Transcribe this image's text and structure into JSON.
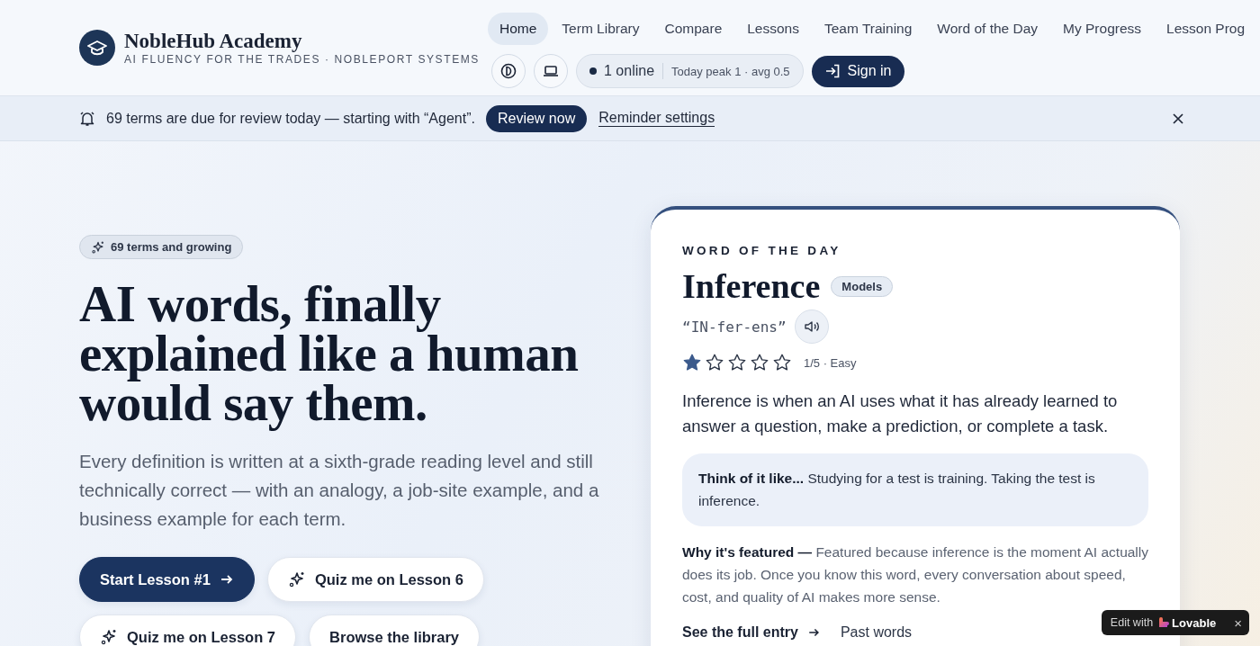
{
  "brand": {
    "name": "NobleHub Academy",
    "tagline": "AI FLUENCY FOR THE TRADES · NOBLEPORT SYSTEMS"
  },
  "nav": [
    {
      "label": "Home",
      "selected": true
    },
    {
      "label": "Term Library",
      "selected": false
    },
    {
      "label": "Compare",
      "selected": false
    },
    {
      "label": "Lessons",
      "selected": false
    },
    {
      "label": "Team Training",
      "selected": false
    },
    {
      "label": "Word of the Day",
      "selected": false
    },
    {
      "label": "My Progress",
      "selected": false
    },
    {
      "label": "Lesson Prog",
      "selected": false
    }
  ],
  "presence": {
    "online": "1 online",
    "stats": "Today peak 1 · avg 0.5"
  },
  "sign_in": "Sign in",
  "banner": {
    "message": "69 terms are due for review today — starting with “Agent”.",
    "primary": "Review now",
    "secondary": "Reminder settings"
  },
  "hero": {
    "badge": "69 terms and growing",
    "headline": "AI words, finally explained like a human would say them.",
    "intro": "Every definition is written at a sixth-grade reading level and still technically correct — with an analogy, a job-site example, and a business example for each term.",
    "buttons": [
      {
        "label": "Start Lesson #1",
        "kind": "primary"
      },
      {
        "label": "Quiz me on Lesson 6",
        "kind": "quiz"
      },
      {
        "label": "Quiz me on Lesson 7",
        "kind": "quiz"
      },
      {
        "label": "Browse the library",
        "kind": "plain"
      }
    ]
  },
  "word_of_the_day": {
    "eyebrow": "WORD OF THE DAY",
    "term": "Inference",
    "category": "Models",
    "pronunciation": "“IN-fer-ens”",
    "stars": 1,
    "difficulty": "1/5 · Easy",
    "definition": "Inference is when an AI uses what it has already learned to answer a question, make a prediction, or complete a task.",
    "analogy": "**Think of it like...** Studying for a test is training. Taking the test is inference.",
    "featured": "**Why it's featured —** Featured because inference is the moment AI actually does its job. Once you know this word, every conversation about speed, cost, and quality of AI makes more sense.",
    "links": [
      "See the full entry",
      "Past words"
    ]
  },
  "edit_badge": {
    "prefix": "Edit with",
    "brand": "Lovable",
    "close": "×"
  }
}
